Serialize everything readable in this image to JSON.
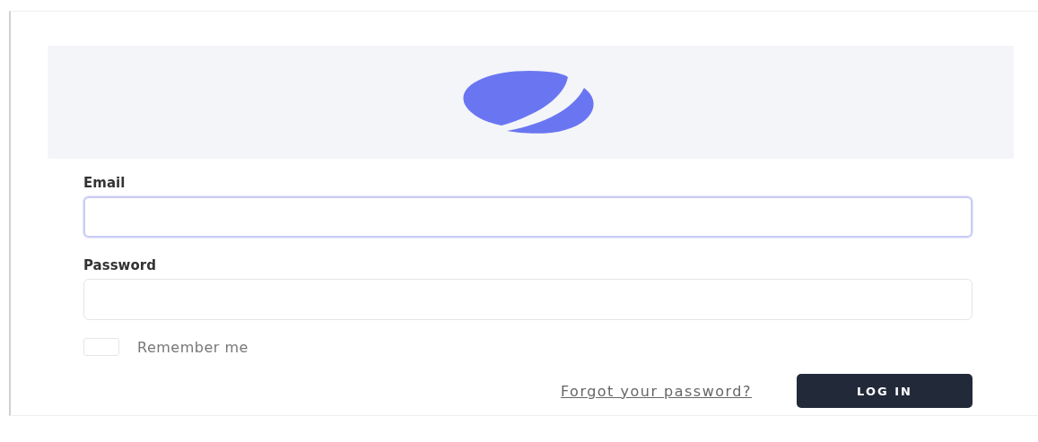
{
  "form": {
    "fields": [
      {
        "label": "Email",
        "focused": true
      },
      {
        "label": "Password",
        "focused": false
      }
    ],
    "remember": {
      "label": "Remember me",
      "checked": false
    },
    "forgot_link": "Forgot your password?",
    "submit_button": "LOG IN"
  }
}
